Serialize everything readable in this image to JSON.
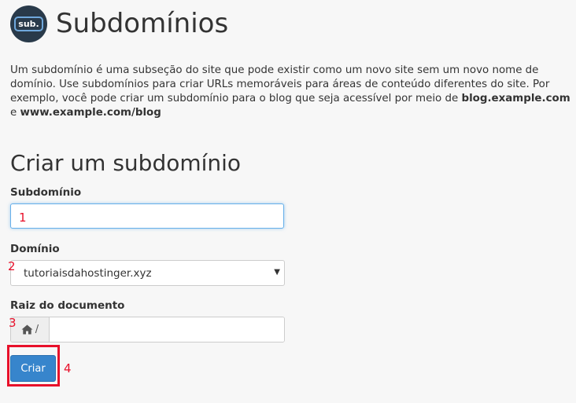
{
  "header": {
    "logo_text": "sub.",
    "title": "Subdomínios"
  },
  "description": {
    "part1": "Um subdomínio é uma subseção do site que pode existir como um novo site sem um novo nome de domínio. Use subdomínios para criar URLs memoráveis para áreas de conteúdo diferentes do site. Por exemplo, você pode criar um subdomínio para o blog que seja acessível por meio de ",
    "example1": "blog.example.com",
    "connector": " e ",
    "example2": "www.example.com/blog"
  },
  "form": {
    "title": "Criar um subdomínio",
    "subdomain": {
      "label": "Subdomínio",
      "value": ""
    },
    "domain": {
      "label": "Domínio",
      "selected": "tutoriaisdahostinger.xyz"
    },
    "document_root": {
      "label": "Raiz do documento",
      "prefix": "/",
      "value": ""
    },
    "submit_label": "Criar"
  },
  "annotations": {
    "step1": "1",
    "step2": "2",
    "step3": "3",
    "step4": "4",
    "color": "#e8102a"
  },
  "colors": {
    "primary_button": "#3785cc",
    "focus_border": "#66afe9",
    "background": "#f7f7f7"
  },
  "icons": {
    "logo": "subdomain-logo-icon",
    "home": "home-icon",
    "select_arrow": "caret-down-icon"
  }
}
